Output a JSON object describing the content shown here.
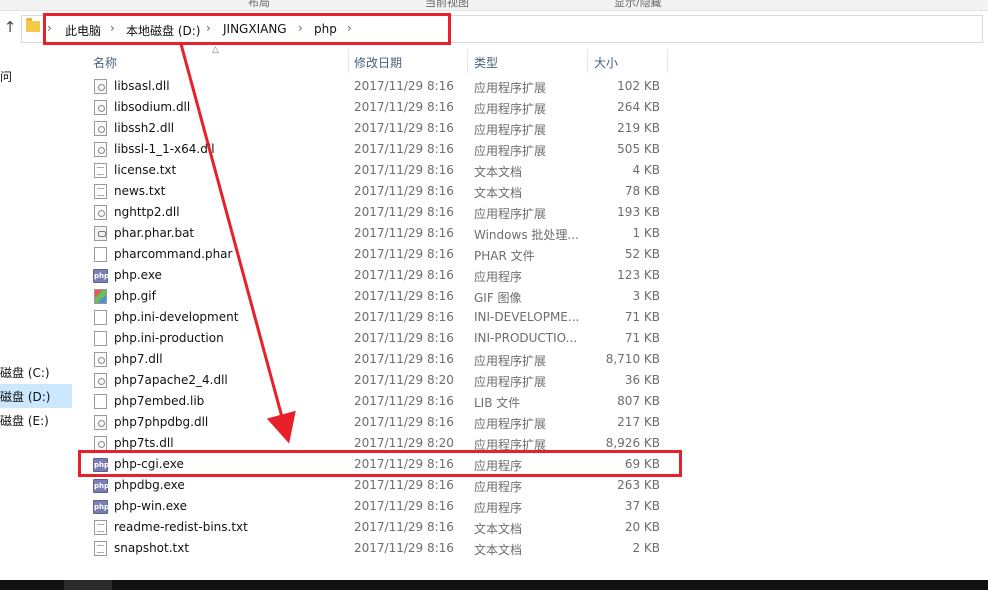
{
  "ribbon": {
    "left_label": "布局",
    "mid_label": "当前视图",
    "right_label": "显示/隐藏"
  },
  "address_bar": {
    "crumbs": [
      "此电脑",
      "本地磁盘 (D:)",
      "JINGXIANG",
      "php"
    ]
  },
  "nav_pane": {
    "partial_label": "问",
    "drives": [
      "磁盘 (C:)",
      "磁盘 (D:)",
      "磁盘 (E:)"
    ],
    "selected_index": 1
  },
  "columns": {
    "name": "名称",
    "date": "修改日期",
    "type": "类型",
    "size": "大小"
  },
  "files": [
    {
      "name": "libsasl.dll",
      "date": "2017/11/29 8:16",
      "type": "应用程序扩展",
      "size": "102 KB",
      "icon": "dll-file-icon"
    },
    {
      "name": "libsodium.dll",
      "date": "2017/11/29 8:16",
      "type": "应用程序扩展",
      "size": "264 KB",
      "icon": "dll-file-icon"
    },
    {
      "name": "libssh2.dll",
      "date": "2017/11/29 8:16",
      "type": "应用程序扩展",
      "size": "219 KB",
      "icon": "dll-file-icon"
    },
    {
      "name": "libssl-1_1-x64.dll",
      "date": "2017/11/29 8:16",
      "type": "应用程序扩展",
      "size": "505 KB",
      "icon": "dll-file-icon"
    },
    {
      "name": "license.txt",
      "date": "2017/11/29 8:16",
      "type": "文本文档",
      "size": "4 KB",
      "icon": "text-file-icon"
    },
    {
      "name": "news.txt",
      "date": "2017/11/29 8:16",
      "type": "文本文档",
      "size": "78 KB",
      "icon": "text-file-icon"
    },
    {
      "name": "nghttp2.dll",
      "date": "2017/11/29 8:16",
      "type": "应用程序扩展",
      "size": "193 KB",
      "icon": "dll-file-icon"
    },
    {
      "name": "phar.phar.bat",
      "date": "2017/11/29 8:16",
      "type": "Windows 批处理...",
      "size": "1 KB",
      "icon": "batch-file-icon"
    },
    {
      "name": "pharcommand.phar",
      "date": "2017/11/29 8:16",
      "type": "PHAR 文件",
      "size": "52 KB",
      "icon": "generic-file-icon"
    },
    {
      "name": "php.exe",
      "date": "2017/11/29 8:16",
      "type": "应用程序",
      "size": "123 KB",
      "icon": "php-exe-icon"
    },
    {
      "name": "php.gif",
      "date": "2017/11/29 8:16",
      "type": "GIF 图像",
      "size": "3 KB",
      "icon": "image-file-icon"
    },
    {
      "name": "php.ini-development",
      "date": "2017/11/29 8:16",
      "type": "INI-DEVELOPME...",
      "size": "71 KB",
      "icon": "generic-file-icon"
    },
    {
      "name": "php.ini-production",
      "date": "2017/11/29 8:16",
      "type": "INI-PRODUCTIO...",
      "size": "71 KB",
      "icon": "generic-file-icon"
    },
    {
      "name": "php7.dll",
      "date": "2017/11/29 8:16",
      "type": "应用程序扩展",
      "size": "8,710 KB",
      "icon": "dll-file-icon"
    },
    {
      "name": "php7apache2_4.dll",
      "date": "2017/11/29 8:20",
      "type": "应用程序扩展",
      "size": "36 KB",
      "icon": "dll-file-icon"
    },
    {
      "name": "php7embed.lib",
      "date": "2017/11/29 8:16",
      "type": "LIB 文件",
      "size": "807 KB",
      "icon": "generic-file-icon"
    },
    {
      "name": "php7phpdbg.dll",
      "date": "2017/11/29 8:16",
      "type": "应用程序扩展",
      "size": "217 KB",
      "icon": "dll-file-icon"
    },
    {
      "name": "php7ts.dll",
      "date": "2017/11/29 8:20",
      "type": "应用程序扩展",
      "size": "8,926 KB",
      "icon": "dll-file-icon"
    },
    {
      "name": "php-cgi.exe",
      "date": "2017/11/29 8:16",
      "type": "应用程序",
      "size": "69 KB",
      "icon": "php-exe-icon"
    },
    {
      "name": "phpdbg.exe",
      "date": "2017/11/29 8:16",
      "type": "应用程序",
      "size": "263 KB",
      "icon": "php-exe-icon"
    },
    {
      "name": "php-win.exe",
      "date": "2017/11/29 8:16",
      "type": "应用程序",
      "size": "37 KB",
      "icon": "php-exe-icon"
    },
    {
      "name": "readme-redist-bins.txt",
      "date": "2017/11/29 8:16",
      "type": "文本文档",
      "size": "20 KB",
      "icon": "text-file-icon"
    },
    {
      "name": "snapshot.txt",
      "date": "2017/11/29 8:16",
      "type": "文本文档",
      "size": "2 KB",
      "icon": "text-file-icon"
    }
  ],
  "php_icon_text": "php",
  "annotation_color": "#e8202a",
  "highlighted_file_index": 18
}
